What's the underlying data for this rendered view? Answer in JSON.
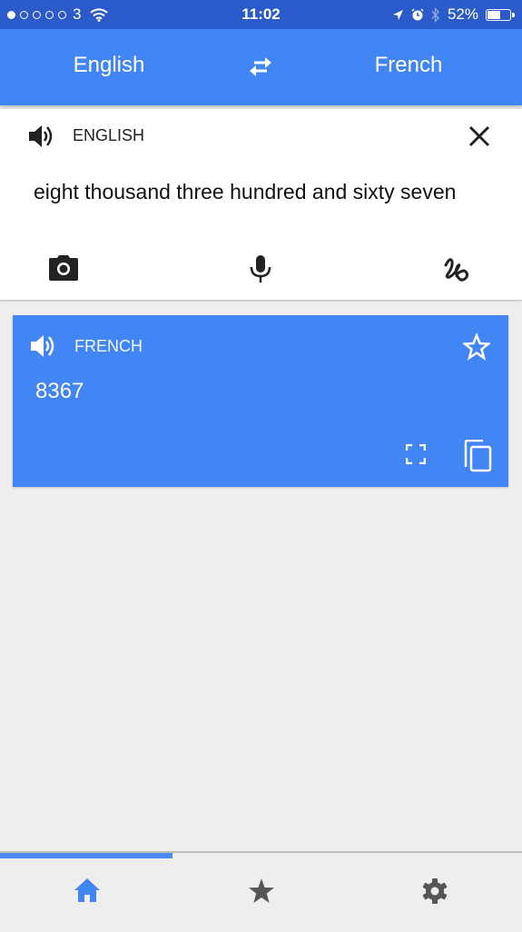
{
  "status_bar": {
    "signal_dots_filled": 1,
    "signal_dots_total": 5,
    "carrier": "3",
    "time": "11:02",
    "battery_percent_label": "52%",
    "battery_level": 0.52
  },
  "header": {
    "source_language": "English",
    "target_language": "French",
    "swap_icon": "swap-arrows-icon"
  },
  "input": {
    "language_label": "ENGLISH",
    "text": "eight thousand three hundred and sixty seven",
    "tools": [
      "camera-icon",
      "microphone-icon",
      "handwriting-icon"
    ]
  },
  "output": {
    "language_label": "FRENCH",
    "text": "8367"
  },
  "bottom_nav": {
    "progress": 0.33,
    "items": [
      "home",
      "favorites",
      "settings"
    ],
    "active": "home"
  },
  "colors": {
    "accent": "#4285f4",
    "status_bar": "#2b5bcb",
    "background": "#eeeeee"
  }
}
